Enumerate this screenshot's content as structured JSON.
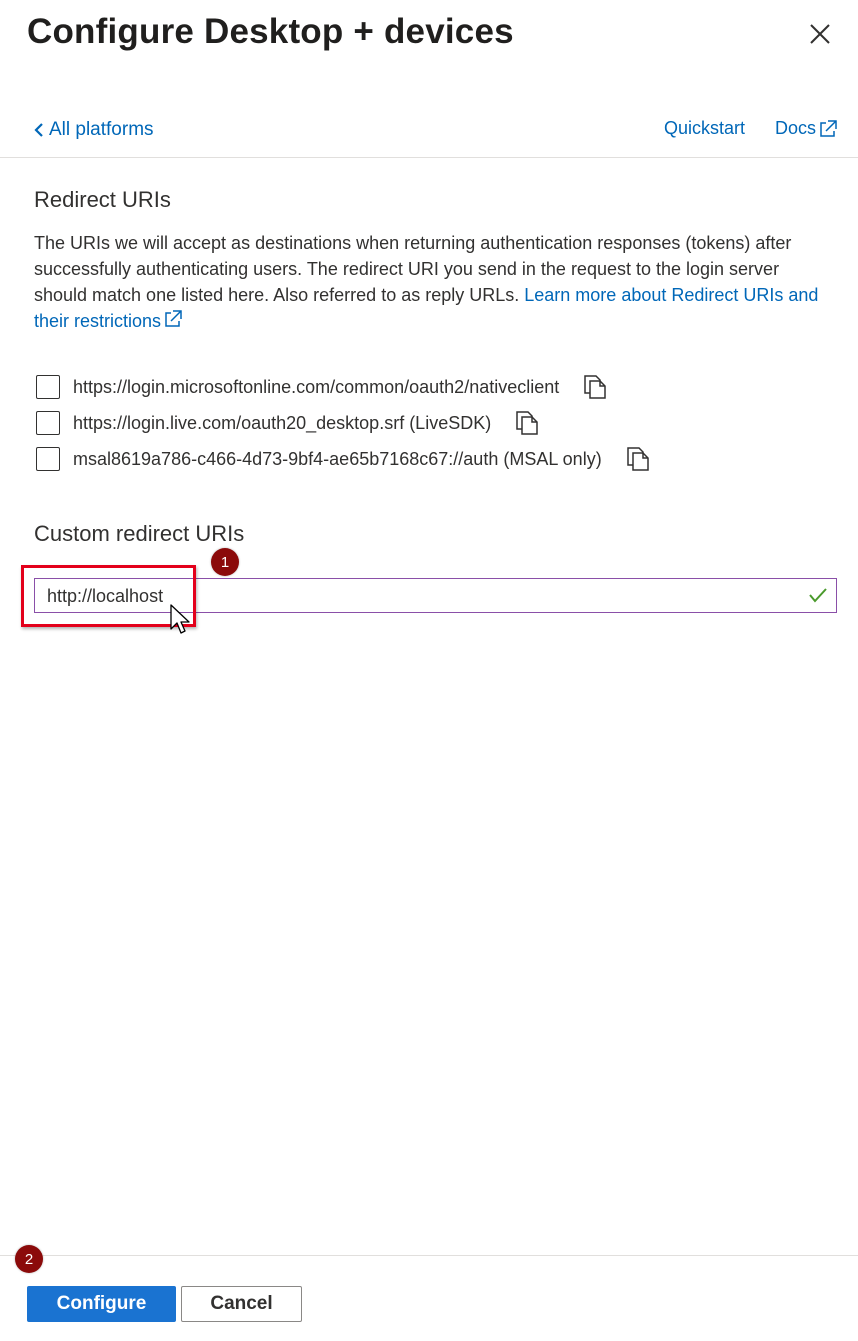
{
  "header": {
    "title": "Configure Desktop + devices"
  },
  "nav": {
    "back_label": "All platforms",
    "quickstart_label": "Quickstart",
    "docs_label": "Docs"
  },
  "redirect": {
    "title": "Redirect URIs",
    "description": "The URIs we will accept as destinations when returning authentication responses (tokens) after successfully authenticating users. The redirect URI you send in the request to the login server should match one listed here. Also referred to as reply URLs.",
    "learn_more_label": "Learn more about Redirect URIs and their restrictions",
    "uris": [
      {
        "label": "https://login.microsoftonline.com/common/oauth2/nativeclient",
        "checked": false
      },
      {
        "label": "https://login.live.com/oauth20_desktop.srf (LiveSDK)",
        "checked": false
      },
      {
        "label": "msal8619a786-c466-4d73-9bf4-ae65b7168c67://auth (MSAL only)",
        "checked": false
      }
    ]
  },
  "custom": {
    "title": "Custom redirect URIs",
    "value": "http://localhost"
  },
  "annotations": {
    "step1": "1",
    "step2": "2"
  },
  "footer": {
    "configure_label": "Configure",
    "cancel_label": "Cancel"
  },
  "colors": {
    "link": "#0067b8",
    "primary_button": "#1a73d1",
    "highlight": "#e3001b",
    "badge": "#8b0a0a",
    "valid_check": "#4a9a2c"
  }
}
